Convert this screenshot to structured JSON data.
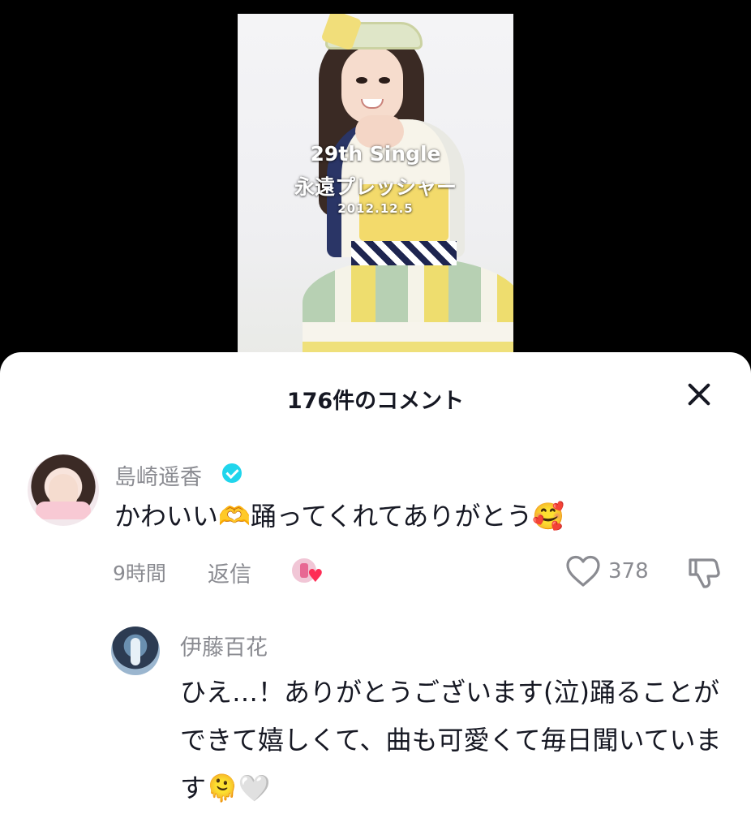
{
  "video": {
    "overlay_line1": "29th Single",
    "overlay_line2": "永遠プレッシャー",
    "overlay_line3": "2012.12.5"
  },
  "comments_sheet": {
    "title": "176件のコメント",
    "close_icon": "close-icon"
  },
  "comment": {
    "username": "島崎遥香",
    "verified": true,
    "text": "かわいい🫶踊ってくれてありがとう🥰",
    "time": "9時間",
    "reply_label": "返信",
    "like_count": "378",
    "creator_liked": true
  },
  "reply": {
    "username": "伊藤百花",
    "text": "ひえ…！ありがとうございます(泣)踊ることができて嬉しくて、曲も可愛くて毎日聞いています🫠🤍"
  },
  "colors": {
    "primary_text": "#161823",
    "secondary_text": "#8a8b91",
    "verified": "#20d5ec",
    "heart": "#fe2c55"
  }
}
